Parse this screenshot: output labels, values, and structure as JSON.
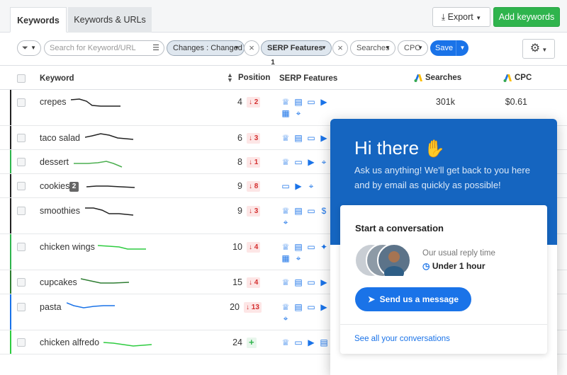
{
  "tabs": {
    "keywords": "Keywords",
    "keywords_urls": "Keywords & URLs"
  },
  "toolbar": {
    "export_label": "Export",
    "add_keywords_label": "Add keywords"
  },
  "filters": {
    "search_placeholder": "Search for Keyword/URL",
    "changes_label": "Changes : Changed",
    "serp_label": "SERP Features",
    "serp_count": "1",
    "searches_label": "Searches",
    "cpc_label": "CPC",
    "save_label": "Save"
  },
  "table": {
    "headers": {
      "keyword": "Keyword",
      "position": "Position",
      "serp": "SERP Features",
      "searches": "Searches",
      "cpc": "CPC"
    },
    "rows": [
      {
        "keyword": "crepes",
        "position": "4",
        "change": "2",
        "searches": "301k",
        "cpc": "$0.61"
      },
      {
        "keyword": "taco salad",
        "position": "6",
        "change": "3",
        "searches": "",
        "cpc": ""
      },
      {
        "keyword": "dessert",
        "position": "8",
        "change": "1",
        "searches": "",
        "cpc": ""
      },
      {
        "keyword": "cookies",
        "tag": "2",
        "position": "9",
        "change": "8",
        "searches": "",
        "cpc": ""
      },
      {
        "keyword": "smoothies",
        "position": "9",
        "change": "3",
        "searches": "",
        "cpc": ""
      },
      {
        "keyword": "chicken wings",
        "position": "10",
        "change": "4",
        "searches": "",
        "cpc": ""
      },
      {
        "keyword": "cupcakes",
        "position": "15",
        "change": "4",
        "searches": "",
        "cpc": ""
      },
      {
        "keyword": "pasta",
        "position": "20",
        "change": "13",
        "searches": "",
        "cpc": ""
      },
      {
        "keyword": "chicken alfredo",
        "position": "24",
        "change": "+",
        "searches": "",
        "cpc": ""
      }
    ]
  },
  "chat": {
    "greeting": "Hi there",
    "subtitle": "Ask us anything! We'll get back to you here and by email as quickly as possible!",
    "card_title": "Start a conversation",
    "reply_label": "Our usual reply time",
    "reply_time": "Under 1 hour",
    "send_label": "Send us a message",
    "see_all": "See all your conversations"
  },
  "colors": {
    "accent": "#1a73e8",
    "brand_green": "#2fb44d",
    "chat_header": "#1565c0",
    "down": "#d32f2f"
  }
}
